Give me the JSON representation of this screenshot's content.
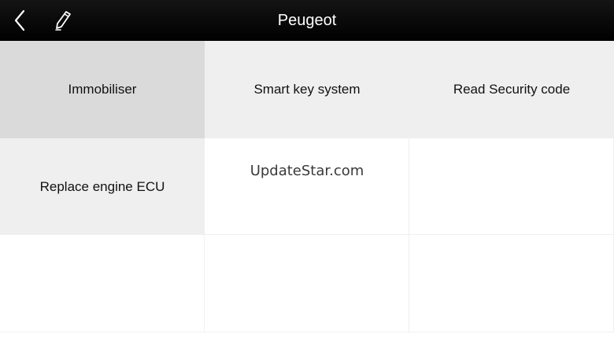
{
  "header": {
    "title": "Peugeot",
    "back_icon": "back-chevron-icon",
    "edit_icon": "pencil-icon"
  },
  "menu": {
    "items": [
      {
        "label": "Immobiliser",
        "state": "selected"
      },
      {
        "label": "Smart key system",
        "state": "normal"
      },
      {
        "label": "Read Security code",
        "state": "normal"
      },
      {
        "label": "Replace engine ECU",
        "state": "normal"
      }
    ]
  },
  "watermark": "UpdateStar.com",
  "colors": {
    "header_bg": "#000000",
    "header_text": "#ffffff",
    "item_bg": "#efefef",
    "item_selected_bg": "#dadada"
  }
}
